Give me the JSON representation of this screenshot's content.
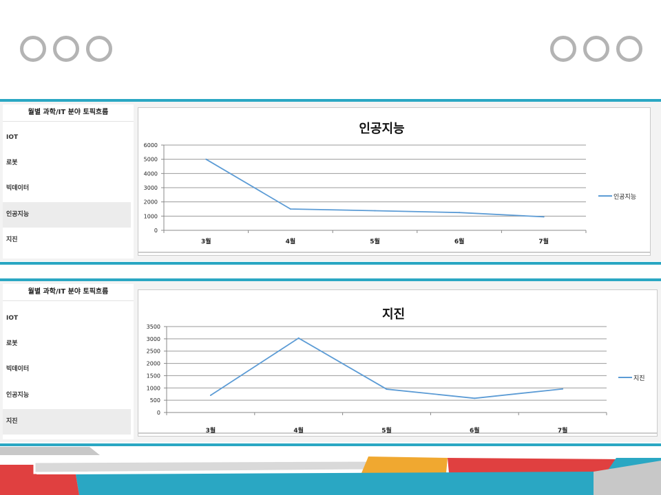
{
  "sidebar_title": "월별 과학/IT 분야 토픽흐름",
  "sidebar_items": [
    "IOT",
    "로봇",
    "빅데이터",
    "인공지능",
    "지진"
  ],
  "colors": {
    "accent": "#2aa7c3",
    "series": "#5b9bd5",
    "red": "#e04040",
    "orange": "#f0a830",
    "gray": "#b4b4b4"
  },
  "chart_data": [
    {
      "type": "line",
      "title": "인공지능",
      "categories": [
        "3월",
        "4월",
        "5월",
        "6월",
        "7월"
      ],
      "series": [
        {
          "name": "인공지능",
          "values": [
            5000,
            1500,
            1380,
            1250,
            950
          ]
        }
      ],
      "yticks": [
        0,
        1000,
        2000,
        3000,
        4000,
        5000,
        6000
      ],
      "ylim": [
        0,
        6000
      ],
      "grid": true,
      "legend": "right"
    },
    {
      "type": "line",
      "title": "지진",
      "categories": [
        "3월",
        "4월",
        "5월",
        "6월",
        "7월"
      ],
      "series": [
        {
          "name": "지진",
          "values": [
            700,
            3030,
            950,
            580,
            960
          ]
        }
      ],
      "yticks": [
        0,
        500,
        1000,
        1500,
        2000,
        2500,
        3000,
        3500
      ],
      "ylim": [
        0,
        3500
      ],
      "grid": true,
      "legend": "right"
    }
  ]
}
